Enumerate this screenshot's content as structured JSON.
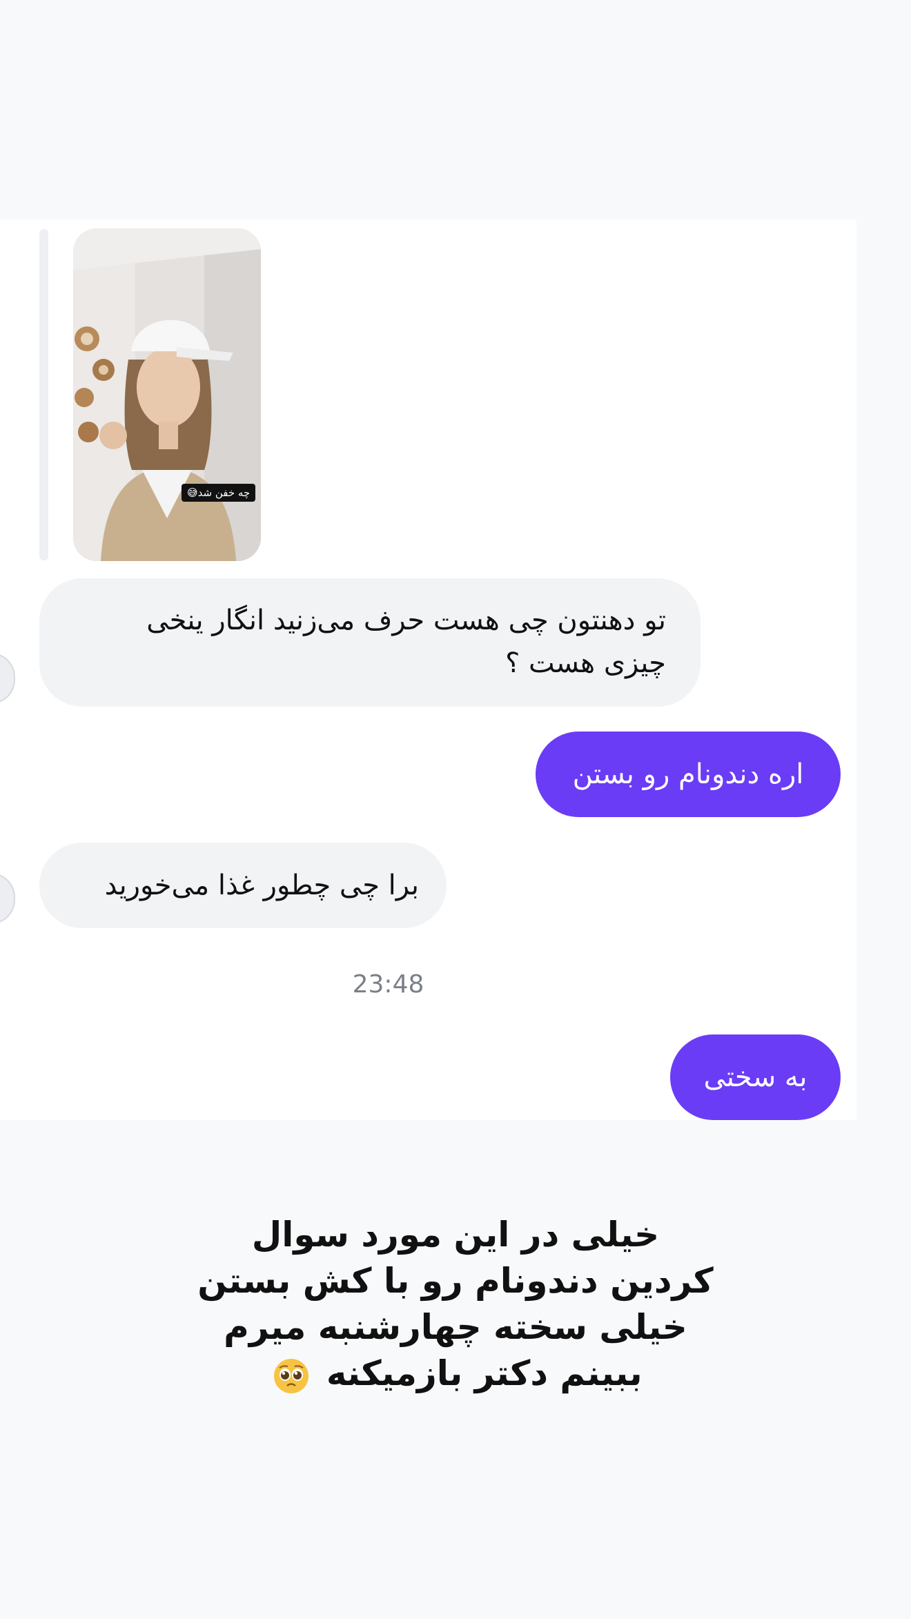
{
  "story_reply": {
    "caption": "چه خفن شد😅"
  },
  "messages": [
    {
      "id": "m1",
      "direction": "incoming",
      "lines": [
        "تو دهنتون چی هست  حرف می‌زنید انگار ینخی",
        "چیزی هست ؟"
      ]
    },
    {
      "id": "m2",
      "direction": "outgoing",
      "text": "اره دندونام رو بستن"
    },
    {
      "id": "m3",
      "direction": "incoming",
      "text": "برا چی چطور غذا می‌خورید"
    },
    {
      "id": "m4",
      "direction": "outgoing",
      "text": "به سختی"
    }
  ],
  "timestamp": "23:48",
  "overlay_text": {
    "lines": [
      "خیلی در این مورد سوال",
      "کردین دندونام رو با کش بستن",
      "خیلی سخته چهارشنبه میرم",
      "ببینم دکتر بازمیکنه"
    ],
    "emoji": "pleading-face-emoji"
  },
  "colors": {
    "page_background": "#f8f9fb",
    "chat_background": "#ffffff",
    "incoming_bubble": "#f2f3f5",
    "outgoing_bubble": "#6a3cf6",
    "timestamp_text": "#7b7f88"
  }
}
